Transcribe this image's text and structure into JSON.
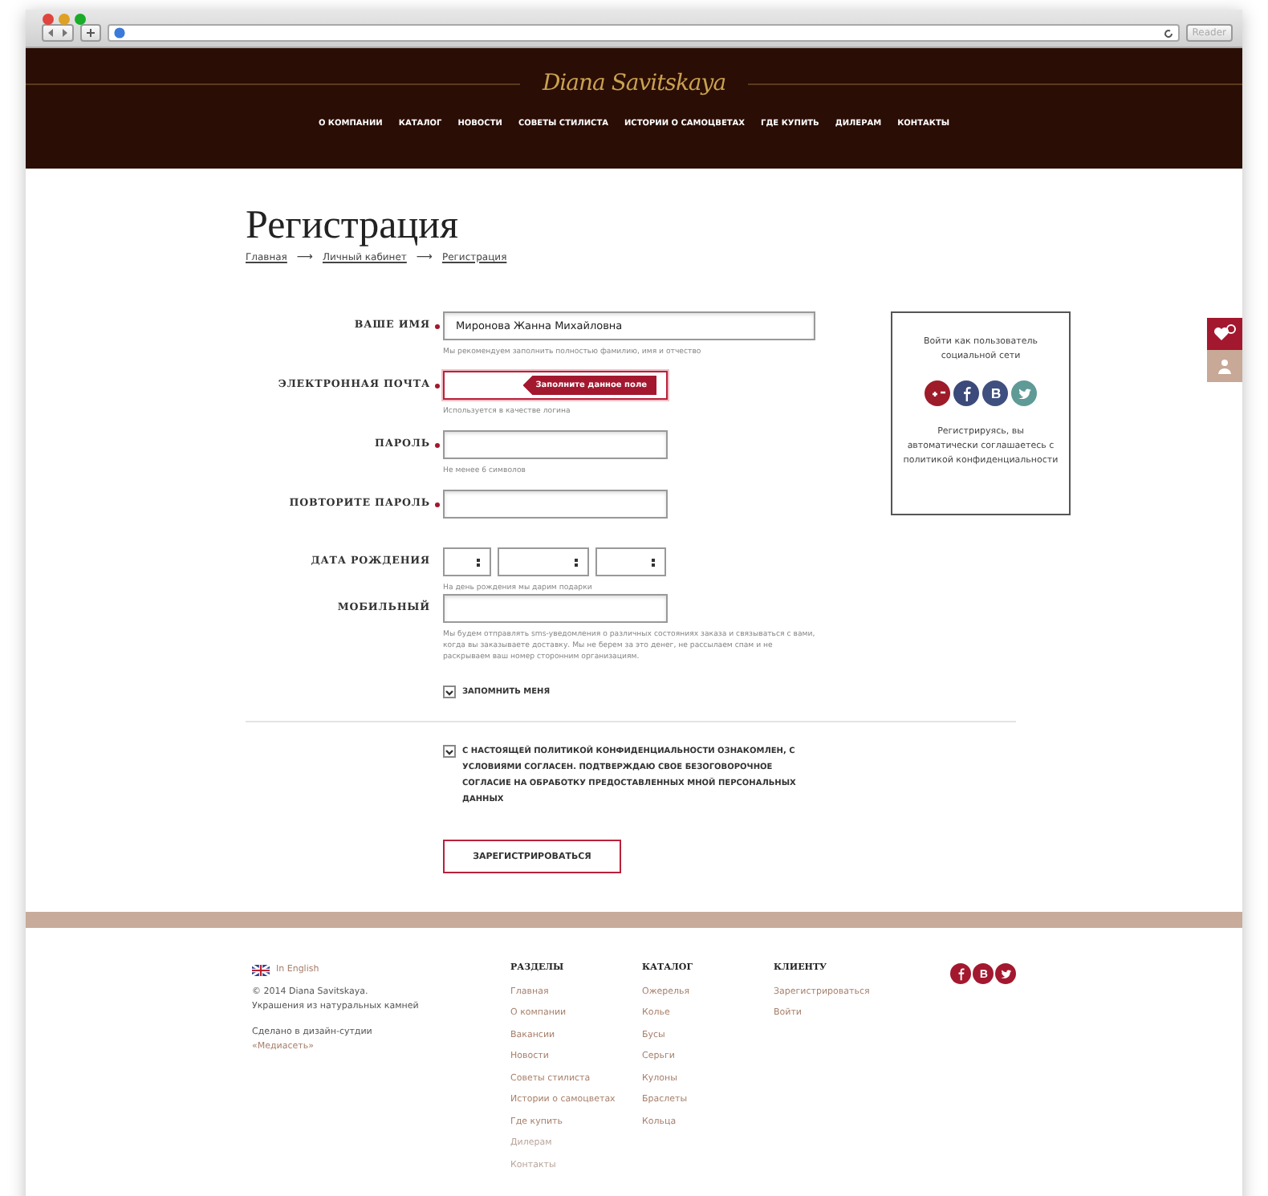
{
  "browser": {
    "reader_label": "Reader"
  },
  "header": {
    "logo": "Diana Savitskaya",
    "nav": [
      {
        "label": "О КОМПАНИИ"
      },
      {
        "label": "КАТАЛОГ"
      },
      {
        "label": "НОВОСТИ"
      },
      {
        "label": "СОВЕТЫ СТИЛИСТА"
      },
      {
        "label": "ИСТОРИИ О САМОЦВЕТАХ"
      },
      {
        "label": "ГДЕ КУПИТЬ"
      },
      {
        "label": "ДИЛЕРАМ"
      },
      {
        "label": "КОНТАКТЫ"
      }
    ]
  },
  "page": {
    "title": "Регистрация",
    "breadcrumbs": [
      {
        "label": "Главная"
      },
      {
        "label": "Личный кабинет"
      },
      {
        "label": "Регистрация"
      }
    ],
    "breadcrumb_separator": "⟶"
  },
  "form": {
    "fields": [
      {
        "kind": "text",
        "label": "ВАШЕ ИМЯ",
        "required": true,
        "wide": true,
        "value": "Миронова Жанна Михайловна",
        "hint": "Мы рекомендуем заполнить полностью фамилию, имя и отчество"
      },
      {
        "kind": "text",
        "label": "ЭЛЕКТРОННАЯ ПОЧТА",
        "required": true,
        "wide": false,
        "error": "Заполните данное поле",
        "hint": "Используется в качестве логина"
      },
      {
        "kind": "text",
        "label": "ПАРОЛЬ",
        "required": true,
        "wide": false,
        "hint": "Не менее 6 символов"
      },
      {
        "kind": "text",
        "label": "ПОВТОРИТЕ ПАРОЛЬ",
        "required": true,
        "wide": false
      },
      {
        "kind": "date",
        "label": "ДАТА РОЖДЕНИЯ",
        "required": false,
        "hint": "На день рождения мы дарим подарки"
      },
      {
        "kind": "text",
        "label": "МОБИЛЬНЫЙ",
        "required": false,
        "wide": false,
        "hint": "Мы будем отправлять sms-уведомления о различных состояниях заказа и связываться с вами, когда вы заказываете доставку. Мы не берем за это денег, не рассылаем спам и не раскрываем ваш номер сторонним организациям."
      }
    ],
    "remember": {
      "label": "ЗАПОМНИТЬ МЕНЯ",
      "checked": true
    },
    "consent": {
      "label": "С НАСТОЯЩЕЙ ПОЛИТИКОЙ КОНФИДЕНЦИАЛЬНОСТИ ОЗНАКОМЛЕН, С УСЛОВИЯМИ СОГЛАСЕН. ПОДТВЕРЖДАЮ СВОЕ БЕЗОГОВОРОЧНОЕ СОГЛАСИЕ НА ОБРАБОТКУ ПРЕДОСТАВЛЕННЫХ МНОЙ ПЕРСОНАЛЬНЫХ ДАННЫХ",
      "checked": true
    },
    "submit": "ЗАРЕГИСТРИРОВАТЬСЯ"
  },
  "social_box": {
    "title": "Войти как пользователь социальной сети",
    "networks": [
      {
        "kind": "gplus",
        "color": "#9e1b2a"
      },
      {
        "kind": "facebook",
        "color": "#3b4a7a"
      },
      {
        "kind": "vk",
        "color": "#3f4f7f"
      },
      {
        "kind": "twitter",
        "color": "#5f9a96"
      }
    ],
    "note": "Регистрируясь, вы автоматически соглашаетесь с политикой конфиденциальности"
  },
  "side_tabs": [
    {
      "kind": "favorites",
      "selected": true
    },
    {
      "kind": "account",
      "selected": false
    }
  ],
  "footer": {
    "language": "In English",
    "copyright": "© 2014 Diana Savitskaya.",
    "tagline": "Украшения из натуральных камней",
    "made_by": "Сделано в дизайн-сутдии",
    "studio": "«Медиасеть»",
    "columns": [
      {
        "title": "РАЗДЕЛЫ",
        "links": [
          {
            "label": "Главная",
            "faded": false
          },
          {
            "label": "О компании",
            "faded": false
          },
          {
            "label": "Вакансии",
            "faded": false
          },
          {
            "label": "Новости",
            "faded": false
          },
          {
            "label": "Советы стилиста",
            "faded": false
          },
          {
            "label": "Истории о самоцветах",
            "faded": false
          },
          {
            "label": "Где купить",
            "faded": false
          },
          {
            "label": "Дилерам",
            "faded": true
          },
          {
            "label": "Контакты",
            "faded": true
          }
        ]
      },
      {
        "title": "КАТАЛОГ",
        "links": [
          {
            "label": "Ожерелья",
            "faded": false
          },
          {
            "label": "Колье",
            "faded": false
          },
          {
            "label": "Бусы",
            "faded": false
          },
          {
            "label": "Серьги",
            "faded": false
          },
          {
            "label": "Кулоны",
            "faded": false
          },
          {
            "label": "Браслеты",
            "faded": false
          },
          {
            "label": "Кольца",
            "faded": false
          }
        ]
      },
      {
        "title": "КЛИЕНТУ",
        "links": [
          {
            "label": "Зарегистрироваться",
            "faded": false
          },
          {
            "label": "Войти",
            "faded": false
          }
        ]
      }
    ],
    "social": [
      {
        "kind": "facebook"
      },
      {
        "kind": "vk"
      },
      {
        "kind": "twitter"
      }
    ]
  }
}
